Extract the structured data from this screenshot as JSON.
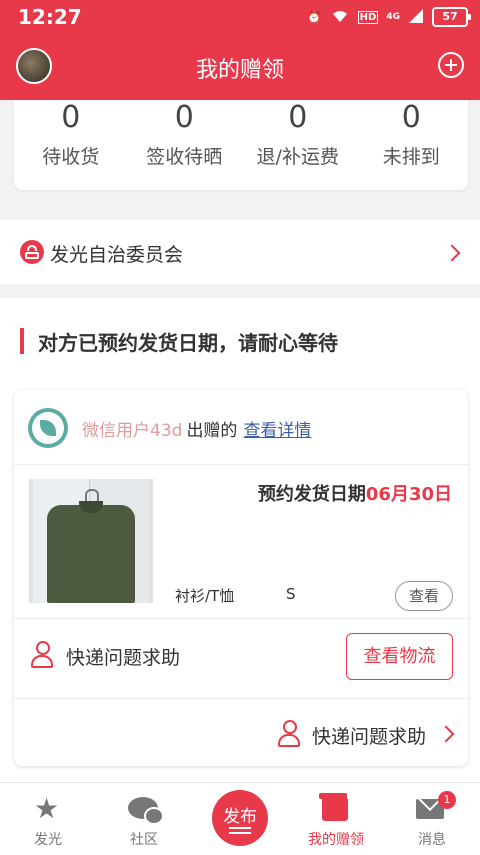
{
  "status_bar": {
    "time": "12:27",
    "network": "4G",
    "hd": "HD",
    "battery": "57"
  },
  "header": {
    "title": "我的赠领"
  },
  "stats": [
    {
      "value": "0",
      "label": "待收货"
    },
    {
      "value": "0",
      "label": "签收待晒"
    },
    {
      "value": "0",
      "label": "退/补运费"
    },
    {
      "value": "0",
      "label": "未排到"
    }
  ],
  "committee": {
    "label": "发光自治委员会"
  },
  "notice": "对方已预约发货日期，请耐心等待",
  "order": {
    "giver_name": "微信用户43d",
    "giver_verb": "出赠的",
    "detail_link": "查看详情",
    "ship_label": "预约发货日期",
    "ship_date": "06月30日",
    "category": "衬衫/T恤",
    "size": "S",
    "view_label": "查看",
    "help_label": "快递问题求助",
    "logistics_label": "查看物流",
    "help_label_2": "快递问题求助"
  },
  "nav": [
    {
      "label": "发光",
      "icon": "star-icon",
      "active": false
    },
    {
      "label": "社区",
      "icon": "chat-icon",
      "active": false
    },
    {
      "label": "发布",
      "icon": "publish-button",
      "active": false
    },
    {
      "label": "我的赠领",
      "icon": "gift-icon",
      "active": true
    },
    {
      "label": "消息",
      "icon": "mail-icon",
      "active": false,
      "badge": "1"
    }
  ],
  "colors": {
    "accent": "#e8394b",
    "link": "#3b5fa0",
    "giver_name": "#e29a9a"
  }
}
